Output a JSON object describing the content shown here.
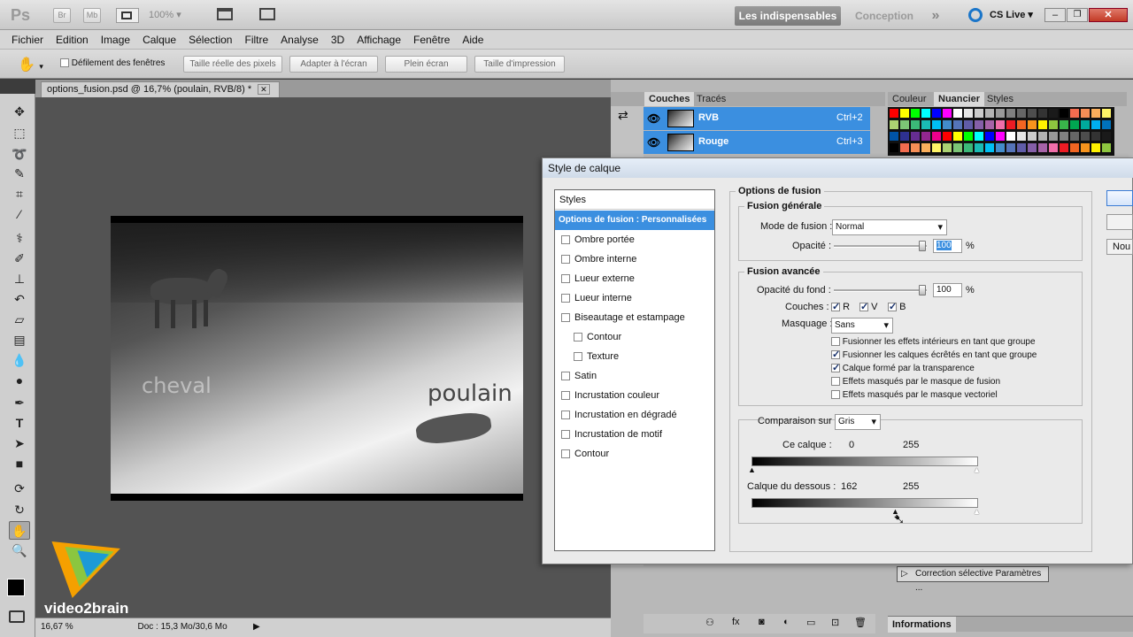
{
  "app": {
    "logo": "Ps",
    "btn_br": "Br",
    "btn_mb": "Mb",
    "zoom": "100%",
    "workspace_active": "Les indispensables",
    "workspace_other": "Conception",
    "more": "»",
    "cslive": "CS Live",
    "win_min": "–",
    "win_max": "❐",
    "win_close": "✕"
  },
  "menu": [
    "Fichier",
    "Edition",
    "Image",
    "Calque",
    "Sélection",
    "Filtre",
    "Analyse",
    "3D",
    "Affichage",
    "Fenêtre",
    "Aide"
  ],
  "options": {
    "scroll_all": "Défilement des fenêtres",
    "actual_pixels": "Taille réelle des pixels",
    "fit_screen": "Adapter à l'écran",
    "fill_screen": "Plein écran",
    "print_size": "Taille d'impression"
  },
  "document": {
    "tab_title": "options_fusion.psd @ 16,7% (poulain, RVB/8) *",
    "close": "✕",
    "text_cheval": "cheval",
    "text_poulain": "poulain",
    "status_zoom": "16,67 %",
    "status_doc": "Doc : 15,3 Mo/30,6 Mo"
  },
  "branding": {
    "name": "video2brain"
  },
  "channels_panel": {
    "tabs": [
      "Couches",
      "Tracés"
    ],
    "rows": [
      {
        "name": "RVB",
        "shortcut": "Ctrl+2"
      },
      {
        "name": "Rouge",
        "shortcut": "Ctrl+3"
      }
    ]
  },
  "swatch_panel": {
    "tabs": [
      "Couleur",
      "Nuancier",
      "Styles"
    ]
  },
  "adjust_panel": {
    "item": "Correction sélective Paramètres ...",
    "info_tab": "Informations"
  },
  "right_dialog": {
    "new_btn": "Nou"
  },
  "dialog": {
    "title": "Style de calque",
    "styles_header": "Styles",
    "style_items": [
      {
        "label": "Options de fusion : Personnalisées",
        "selected": true,
        "check": false,
        "indent": false
      },
      {
        "label": "Ombre portée",
        "selected": false,
        "check": true,
        "indent": false
      },
      {
        "label": "Ombre interne",
        "selected": false,
        "check": true,
        "indent": false
      },
      {
        "label": "Lueur externe",
        "selected": false,
        "check": true,
        "indent": false
      },
      {
        "label": "Lueur interne",
        "selected": false,
        "check": true,
        "indent": false
      },
      {
        "label": "Biseautage et estampage",
        "selected": false,
        "check": true,
        "indent": false
      },
      {
        "label": "Contour",
        "selected": false,
        "check": true,
        "indent": true
      },
      {
        "label": "Texture",
        "selected": false,
        "check": true,
        "indent": true
      },
      {
        "label": "Satin",
        "selected": false,
        "check": true,
        "indent": false
      },
      {
        "label": "Incrustation couleur",
        "selected": false,
        "check": true,
        "indent": false
      },
      {
        "label": "Incrustation en dégradé",
        "selected": false,
        "check": true,
        "indent": false
      },
      {
        "label": "Incrustation de motif",
        "selected": false,
        "check": true,
        "indent": false
      },
      {
        "label": "Contour",
        "selected": false,
        "check": true,
        "indent": false
      }
    ],
    "options_title": "Options de fusion",
    "general": {
      "title": "Fusion générale",
      "mode_label": "Mode de fusion :",
      "mode_value": "Normal",
      "opacity_label": "Opacité :",
      "opacity_value": "100",
      "opacity_level": 1.0,
      "pct": "%"
    },
    "advanced": {
      "title": "Fusion avancée",
      "fill_label": "Opacité du fond :",
      "fill_value": "100",
      "fill_level": 1.0,
      "pct": "%",
      "channels_label": "Couches :",
      "ch_r": "R",
      "ch_v": "V",
      "ch_b": "B",
      "knockout_label": "Masquage :",
      "knockout_value": "Sans",
      "checks": [
        {
          "label": "Fusionner les effets intérieurs en tant que groupe",
          "on": false
        },
        {
          "label": "Fusionner les calques écrêtés en tant que groupe",
          "on": true
        },
        {
          "label": "Calque formé par la transparence",
          "on": true
        },
        {
          "label": "Effets masqués par le masque de fusion",
          "on": false
        },
        {
          "label": "Effets masqués par le masque vectoriel",
          "on": false
        }
      ]
    },
    "blendif": {
      "label": "Comparaison sur :",
      "value": "Gris",
      "this_layer_label": "Ce calque :",
      "this_low": "0",
      "this_high": "255",
      "under_label": "Calque du dessous :",
      "under_low": "162",
      "under_high": "255"
    }
  }
}
